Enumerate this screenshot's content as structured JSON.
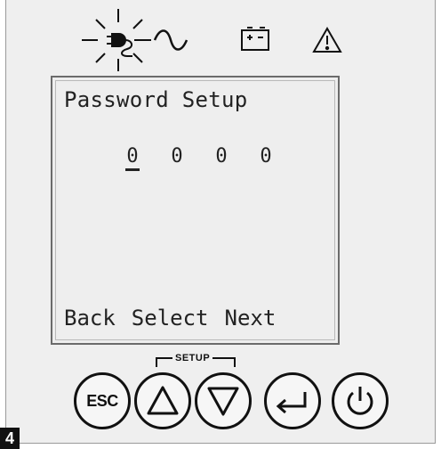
{
  "lcd": {
    "title": "Password Setup",
    "digits": [
      "0",
      "0",
      "0",
      "0"
    ],
    "active_digit_index": 0,
    "softkeys": [
      "Back",
      "Select",
      "Next"
    ]
  },
  "status_icons": [
    "ac-input-icon",
    "sine-wave-icon",
    "battery-icon",
    "warning-icon"
  ],
  "buttons": {
    "esc_label": "ESC",
    "setup_group_label": "SETUP"
  },
  "figure_number": "4"
}
